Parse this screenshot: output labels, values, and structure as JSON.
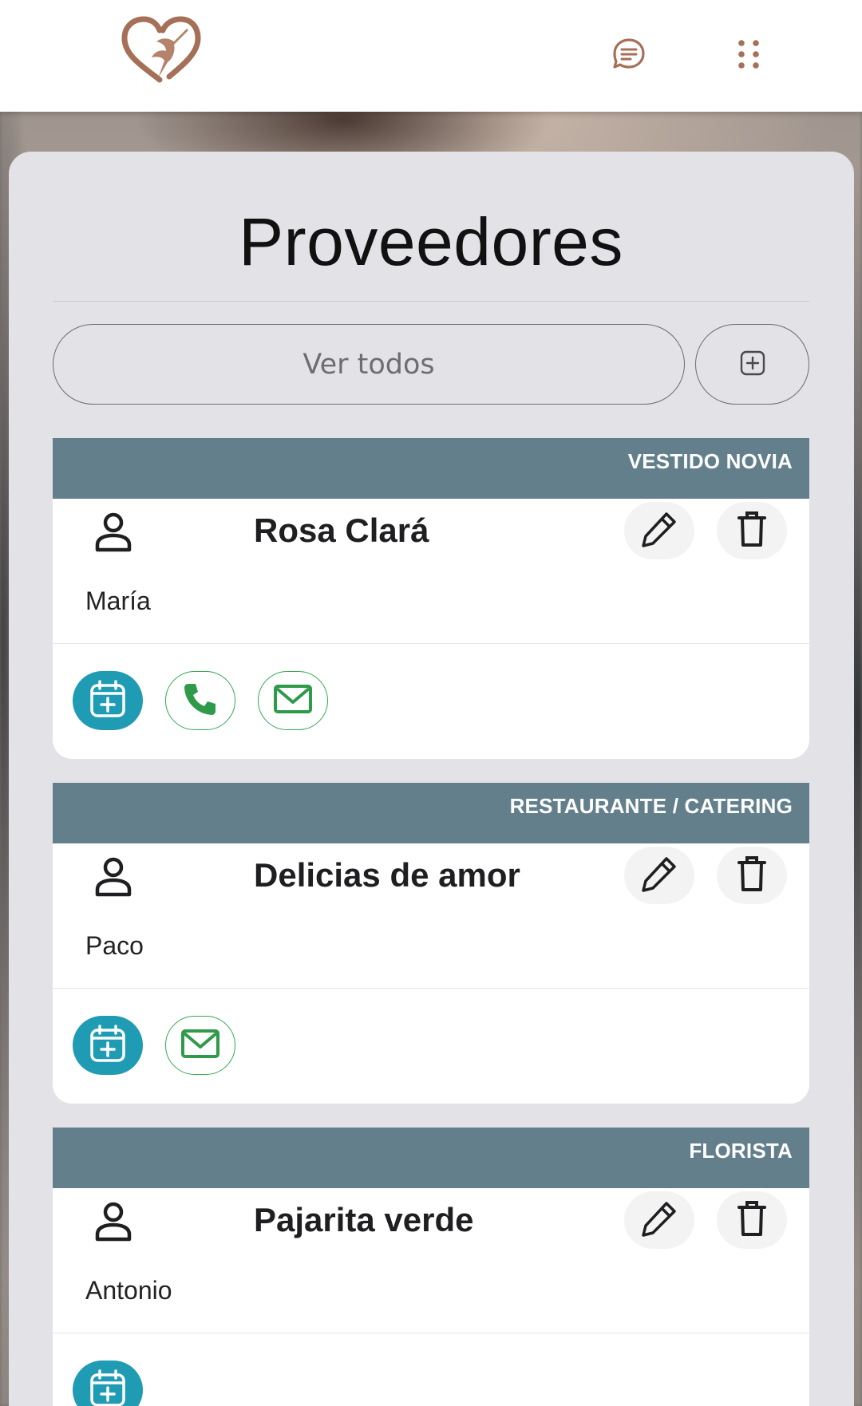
{
  "header": {
    "logo": "hummingbird-heart-logo",
    "icons": {
      "chat": "chat-bubble-icon",
      "menu": "dots-grid-icon"
    },
    "brand_color": "#a66f57"
  },
  "page": {
    "title": "Proveedores"
  },
  "filters": {
    "view_all_label": "Ver todos",
    "add_icon": "plus-square-icon"
  },
  "colors": {
    "category_bar": "#627f8b",
    "calendar_button": "#1f9bb3",
    "contact_green": "#34a853",
    "panel": "#e3e3e7"
  },
  "providers": [
    {
      "category": "VESTIDO NOVIA",
      "name": "Rosa Clará",
      "contact": "María",
      "actions": [
        "calendar",
        "phone",
        "email"
      ]
    },
    {
      "category": "RESTAURANTE / CATERING",
      "name": "Delicias de amor",
      "contact": "Paco",
      "actions": [
        "calendar",
        "email"
      ]
    },
    {
      "category": "FLORISTA",
      "name": "Pajarita verde",
      "contact": "Antonio",
      "actions": [
        "calendar"
      ]
    }
  ]
}
